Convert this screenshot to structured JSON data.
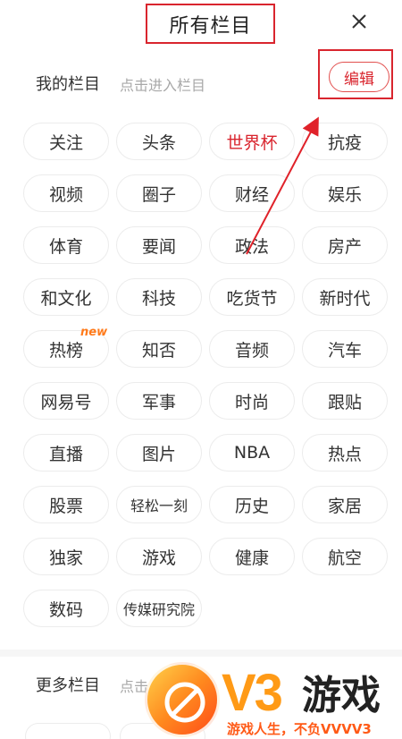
{
  "header": {
    "title": "所有栏目",
    "close_label": "×"
  },
  "my_section": {
    "label": "我的栏目",
    "hint": "点击进入栏目",
    "edit_label": "编辑"
  },
  "channels": [
    {
      "label": "关注"
    },
    {
      "label": "头条"
    },
    {
      "label": "世界杯",
      "accent": "#d9252e"
    },
    {
      "label": "抗疫"
    },
    {
      "label": "视频"
    },
    {
      "label": "圈子"
    },
    {
      "label": "财经"
    },
    {
      "label": "娱乐"
    },
    {
      "label": "体育"
    },
    {
      "label": "要闻"
    },
    {
      "label": "政法"
    },
    {
      "label": "房产"
    },
    {
      "label": "和文化"
    },
    {
      "label": "科技"
    },
    {
      "label": "吃货节"
    },
    {
      "label": "新时代"
    },
    {
      "label": "热榜",
      "badge": "new"
    },
    {
      "label": "知否"
    },
    {
      "label": "音频"
    },
    {
      "label": "汽车"
    },
    {
      "label": "网易号"
    },
    {
      "label": "军事"
    },
    {
      "label": "时尚"
    },
    {
      "label": "跟贴"
    },
    {
      "label": "直播"
    },
    {
      "label": "图片"
    },
    {
      "label": "NBA"
    },
    {
      "label": "热点"
    },
    {
      "label": "股票"
    },
    {
      "label": "轻松一刻"
    },
    {
      "label": "历史"
    },
    {
      "label": "家居"
    },
    {
      "label": "独家"
    },
    {
      "label": "游戏"
    },
    {
      "label": "健康"
    },
    {
      "label": "航空"
    },
    {
      "label": "数码"
    },
    {
      "label": "传媒研究院"
    }
  ],
  "more_section": {
    "label": "更多栏目",
    "hint": "点击"
  },
  "watermark": {
    "brand": "V3",
    "name": "游戏",
    "slogan": "游戏人生，不负VVVV3"
  },
  "colors": {
    "accent": "#d9252e",
    "badge": "#ff7a1a",
    "chip_border": "#ececec",
    "hint": "#a8a8a8"
  }
}
